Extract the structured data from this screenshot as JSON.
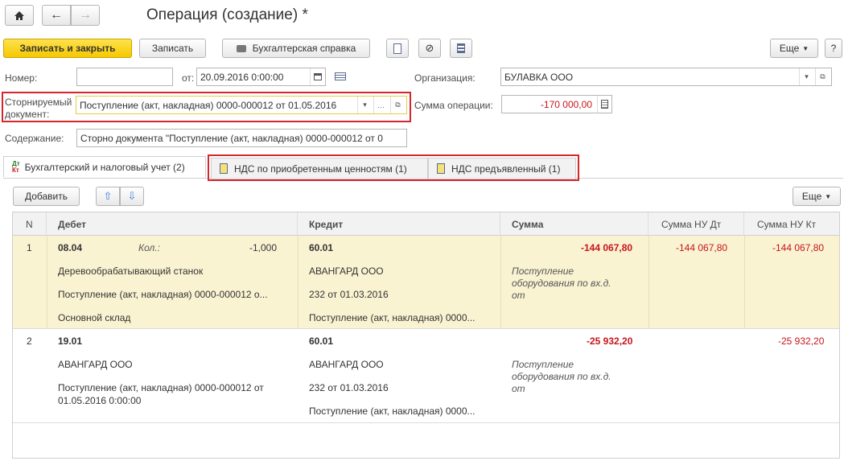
{
  "window": {
    "title": "Операция (создание) *"
  },
  "toolbar": {
    "save_close": "Записать и закрыть",
    "save": "Записать",
    "accounting_ref": "Бухгалтерская справка",
    "more": "Еще",
    "help": "?"
  },
  "form": {
    "number_label": "Номер:",
    "number_value": "",
    "date_label": "от:",
    "date_value": "20.09.2016  0:00:00",
    "org_label": "Организация:",
    "org_value": "БУЛАВКА ООО",
    "storno_label_1": "Сторнируемый",
    "storno_label_2": "документ:",
    "storno_value": "Поступление (акт, накладная) 0000-000012 от 01.05.2016",
    "sum_label": "Сумма операции:",
    "sum_value": "-170 000,00",
    "content_label": "Содержание:",
    "content_value": "Сторно документа \"Поступление (акт, накладная) 0000-000012 от 0"
  },
  "tabs": [
    {
      "label": "Бухгалтерский и налоговый учет (2)"
    },
    {
      "label": "НДС по приобретенным ценностям (1)"
    },
    {
      "label": "НДС предъявленный (1)"
    }
  ],
  "table_toolbar": {
    "add": "Добавить",
    "more": "Еще"
  },
  "table": {
    "headers": {
      "n": "N",
      "debit": "Дебет",
      "credit": "Кредит",
      "sum": "Сумма",
      "sum_nu_dt": "Сумма НУ Дт",
      "sum_nu_kt": "Сумма НУ Кт"
    },
    "rows": [
      {
        "n": "1",
        "debit_account": "08.04",
        "qty_label": "Кол.:",
        "qty_value": "-1,000",
        "debit_sub1": "Деревообрабатывающий станок",
        "debit_sub2": "Поступление (акт, накладная) 0000-000012 о...",
        "debit_sub3": "Основной склад",
        "credit_account": "60.01",
        "credit_sub1": "АВАНГАРД ООО",
        "credit_sub2": "232 от 01.03.2016",
        "credit_sub3": "Поступление (акт, накладная) 0000...",
        "sum": "-144 067,80",
        "comment_1": "Поступление",
        "comment_2": "оборудования по вх.д.",
        "comment_3": "от",
        "sum_nu_dt": "-144 067,80",
        "sum_nu_kt": "-144 067,80"
      },
      {
        "n": "2",
        "debit_account": "19.01",
        "debit_sub1": "АВАНГАРД ООО",
        "debit_sub2": "Поступление (акт, накладная) 0000-000012 от",
        "debit_sub2b": "01.05.2016 0:00:00",
        "credit_account": "60.01",
        "credit_sub1": "АВАНГАРД ООО",
        "credit_sub2": "232 от 01.03.2016",
        "credit_sub3": "Поступление (акт, накладная) 0000...",
        "sum": "-25 932,20",
        "comment_1": "Поступление",
        "comment_2": "оборудования по вх.д.",
        "comment_3": "от",
        "sum_nu_dt": "",
        "sum_nu_kt": "-25 932,20"
      }
    ]
  },
  "colors": {
    "accent_yellow": "#f5c800",
    "highlight_row": "#faf3d2",
    "red": "#c8141b",
    "frame_red": "#d4262d"
  }
}
